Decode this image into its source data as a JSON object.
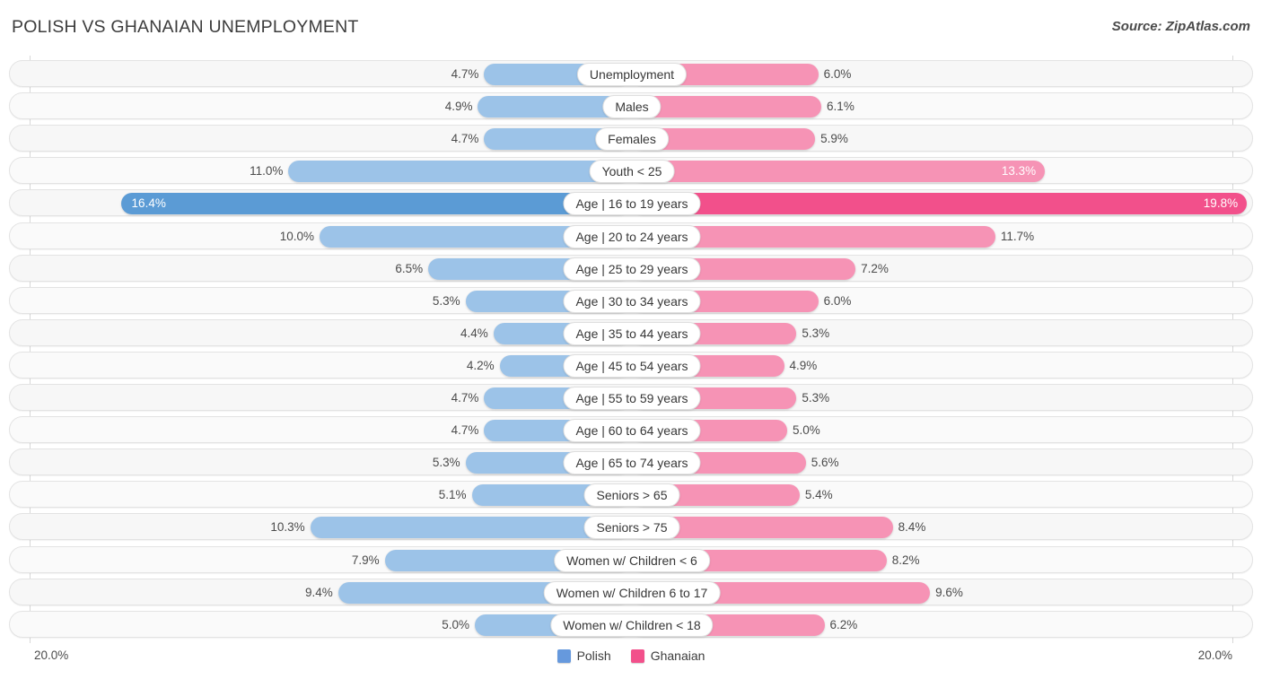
{
  "header": {
    "title": "POLISH VS GHANAIAN UNEMPLOYMENT",
    "source": "Source: ZipAtlas.com"
  },
  "axis": {
    "left_label": "20.0%",
    "right_label": "20.0%",
    "max": 20.0
  },
  "legend": {
    "items": [
      {
        "label": "Polish",
        "color": "#6699dd"
      },
      {
        "label": "Ghanaian",
        "color": "#f2508b"
      }
    ]
  },
  "colors": {
    "polish": "#9cc3e8",
    "ghanaian": "#f693b5",
    "polish_highlight": "#5b9bd5",
    "ghanaian_highlight": "#f2508b",
    "track": "#f7f7f7",
    "gridline": "#d8d8d8"
  },
  "chart_data": {
    "type": "bar",
    "orientation": "diverging-horizontal",
    "title": "POLISH VS GHANAIAN UNEMPLOYMENT",
    "xlabel": "",
    "ylabel": "",
    "xlim": [
      20.0,
      20.0
    ],
    "grid": true,
    "legend_position": "bottom-center",
    "categories": [
      "Unemployment",
      "Males",
      "Females",
      "Youth < 25",
      "Age | 16 to 19 years",
      "Age | 20 to 24 years",
      "Age | 25 to 29 years",
      "Age | 30 to 34 years",
      "Age | 35 to 44 years",
      "Age | 45 to 54 years",
      "Age | 55 to 59 years",
      "Age | 60 to 64 years",
      "Age | 65 to 74 years",
      "Seniors > 65",
      "Seniors > 75",
      "Women w/ Children < 6",
      "Women w/ Children 6 to 17",
      "Women w/ Children < 18"
    ],
    "series": [
      {
        "name": "Polish",
        "values": [
          4.7,
          4.9,
          4.7,
          11.0,
          16.4,
          10.0,
          6.5,
          5.3,
          4.4,
          4.2,
          4.7,
          4.7,
          5.3,
          5.1,
          10.3,
          7.9,
          9.4,
          5.0
        ]
      },
      {
        "name": "Ghanaian",
        "values": [
          6.0,
          6.1,
          5.9,
          13.3,
          19.8,
          11.7,
          7.2,
          6.0,
          5.3,
          4.9,
          5.3,
          5.0,
          5.6,
          5.4,
          8.4,
          8.2,
          9.6,
          6.2
        ]
      }
    ]
  },
  "rows": [
    {
      "label": "Unemployment",
      "left": "4.7%",
      "right": "6.0%",
      "left_val": 4.7,
      "right_val": 6.0,
      "left_inside": false,
      "right_inside": false,
      "highlight": false
    },
    {
      "label": "Males",
      "left": "4.9%",
      "right": "6.1%",
      "left_val": 4.9,
      "right_val": 6.1,
      "left_inside": false,
      "right_inside": false,
      "highlight": false
    },
    {
      "label": "Females",
      "left": "4.7%",
      "right": "5.9%",
      "left_val": 4.7,
      "right_val": 5.9,
      "left_inside": false,
      "right_inside": false,
      "highlight": false
    },
    {
      "label": "Youth < 25",
      "left": "11.0%",
      "right": "13.3%",
      "left_val": 11.0,
      "right_val": 13.3,
      "left_inside": false,
      "right_inside": true,
      "highlight": false
    },
    {
      "label": "Age | 16 to 19 years",
      "left": "16.4%",
      "right": "19.8%",
      "left_val": 16.4,
      "right_val": 19.8,
      "left_inside": true,
      "right_inside": true,
      "highlight": true
    },
    {
      "label": "Age | 20 to 24 years",
      "left": "10.0%",
      "right": "11.7%",
      "left_val": 10.0,
      "right_val": 11.7,
      "left_inside": false,
      "right_inside": false,
      "highlight": false
    },
    {
      "label": "Age | 25 to 29 years",
      "left": "6.5%",
      "right": "7.2%",
      "left_val": 6.5,
      "right_val": 7.2,
      "left_inside": false,
      "right_inside": false,
      "highlight": false
    },
    {
      "label": "Age | 30 to 34 years",
      "left": "5.3%",
      "right": "6.0%",
      "left_val": 5.3,
      "right_val": 6.0,
      "left_inside": false,
      "right_inside": false,
      "highlight": false
    },
    {
      "label": "Age | 35 to 44 years",
      "left": "4.4%",
      "right": "5.3%",
      "left_val": 4.4,
      "right_val": 5.3,
      "left_inside": false,
      "right_inside": false,
      "highlight": false
    },
    {
      "label": "Age | 45 to 54 years",
      "left": "4.2%",
      "right": "4.9%",
      "left_val": 4.2,
      "right_val": 4.9,
      "left_inside": false,
      "right_inside": false,
      "highlight": false
    },
    {
      "label": "Age | 55 to 59 years",
      "left": "4.7%",
      "right": "5.3%",
      "left_val": 4.7,
      "right_val": 5.3,
      "left_inside": false,
      "right_inside": false,
      "highlight": false
    },
    {
      "label": "Age | 60 to 64 years",
      "left": "4.7%",
      "right": "5.0%",
      "left_val": 4.7,
      "right_val": 5.0,
      "left_inside": false,
      "right_inside": false,
      "highlight": false
    },
    {
      "label": "Age | 65 to 74 years",
      "left": "5.3%",
      "right": "5.6%",
      "left_val": 5.3,
      "right_val": 5.6,
      "left_inside": false,
      "right_inside": false,
      "highlight": false
    },
    {
      "label": "Seniors > 65",
      "left": "5.1%",
      "right": "5.4%",
      "left_val": 5.1,
      "right_val": 5.4,
      "left_inside": false,
      "right_inside": false,
      "highlight": false
    },
    {
      "label": "Seniors > 75",
      "left": "10.3%",
      "right": "8.4%",
      "left_val": 10.3,
      "right_val": 8.4,
      "left_inside": false,
      "right_inside": false,
      "highlight": false
    },
    {
      "label": "Women w/ Children < 6",
      "left": "7.9%",
      "right": "8.2%",
      "left_val": 7.9,
      "right_val": 8.2,
      "left_inside": false,
      "right_inside": false,
      "highlight": false
    },
    {
      "label": "Women w/ Children 6 to 17",
      "left": "9.4%",
      "right": "9.6%",
      "left_val": 9.4,
      "right_val": 9.6,
      "left_inside": false,
      "right_inside": false,
      "highlight": false
    },
    {
      "label": "Women w/ Children < 18",
      "left": "5.0%",
      "right": "6.2%",
      "left_val": 5.0,
      "right_val": 6.2,
      "left_inside": false,
      "right_inside": false,
      "highlight": false
    }
  ]
}
